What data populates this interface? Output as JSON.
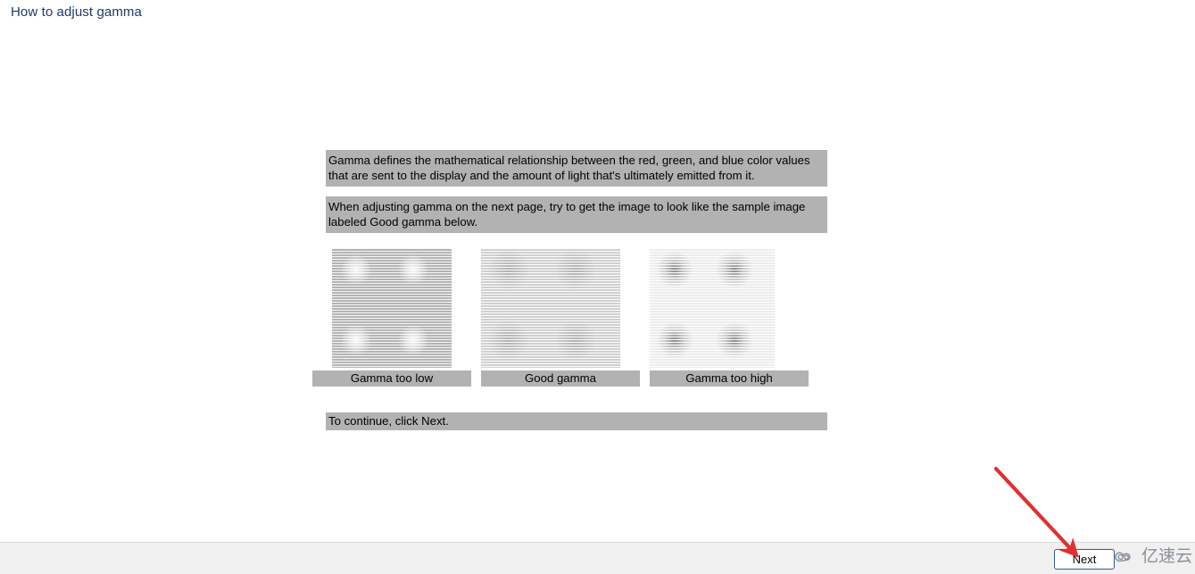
{
  "page": {
    "title": "How to adjust gamma",
    "title_color": "#1f3864",
    "background": "#ffffff"
  },
  "wizard": {
    "intro_paragraph": "Gamma defines the mathematical relationship between the red, green, and blue color values that are sent to the display and the amount of light that's ultimately emitted from it.",
    "instruction_paragraph": "When adjusting gamma on the next page, try to get the image to look like the sample image labeled Good gamma below.",
    "continue_note": "To continue, click Next.",
    "highlight_color": "#b2b2b2",
    "samples": [
      {
        "label": "Gamma too low",
        "variant": "low"
      },
      {
        "label": "Good gamma",
        "variant": "good"
      },
      {
        "label": "Gamma too high",
        "variant": "high"
      }
    ]
  },
  "footer": {
    "background": "#f0f0f0",
    "next_label": "Next",
    "next_border_color": "#2f5c8f"
  },
  "annotation": {
    "arrow_color": "#e03030",
    "arrow_name": "red-arrow-pointing-to-next"
  },
  "watermark": {
    "text": "亿速云",
    "color": "#8a8f9a",
    "icon": "cloud-spiral-icon"
  }
}
